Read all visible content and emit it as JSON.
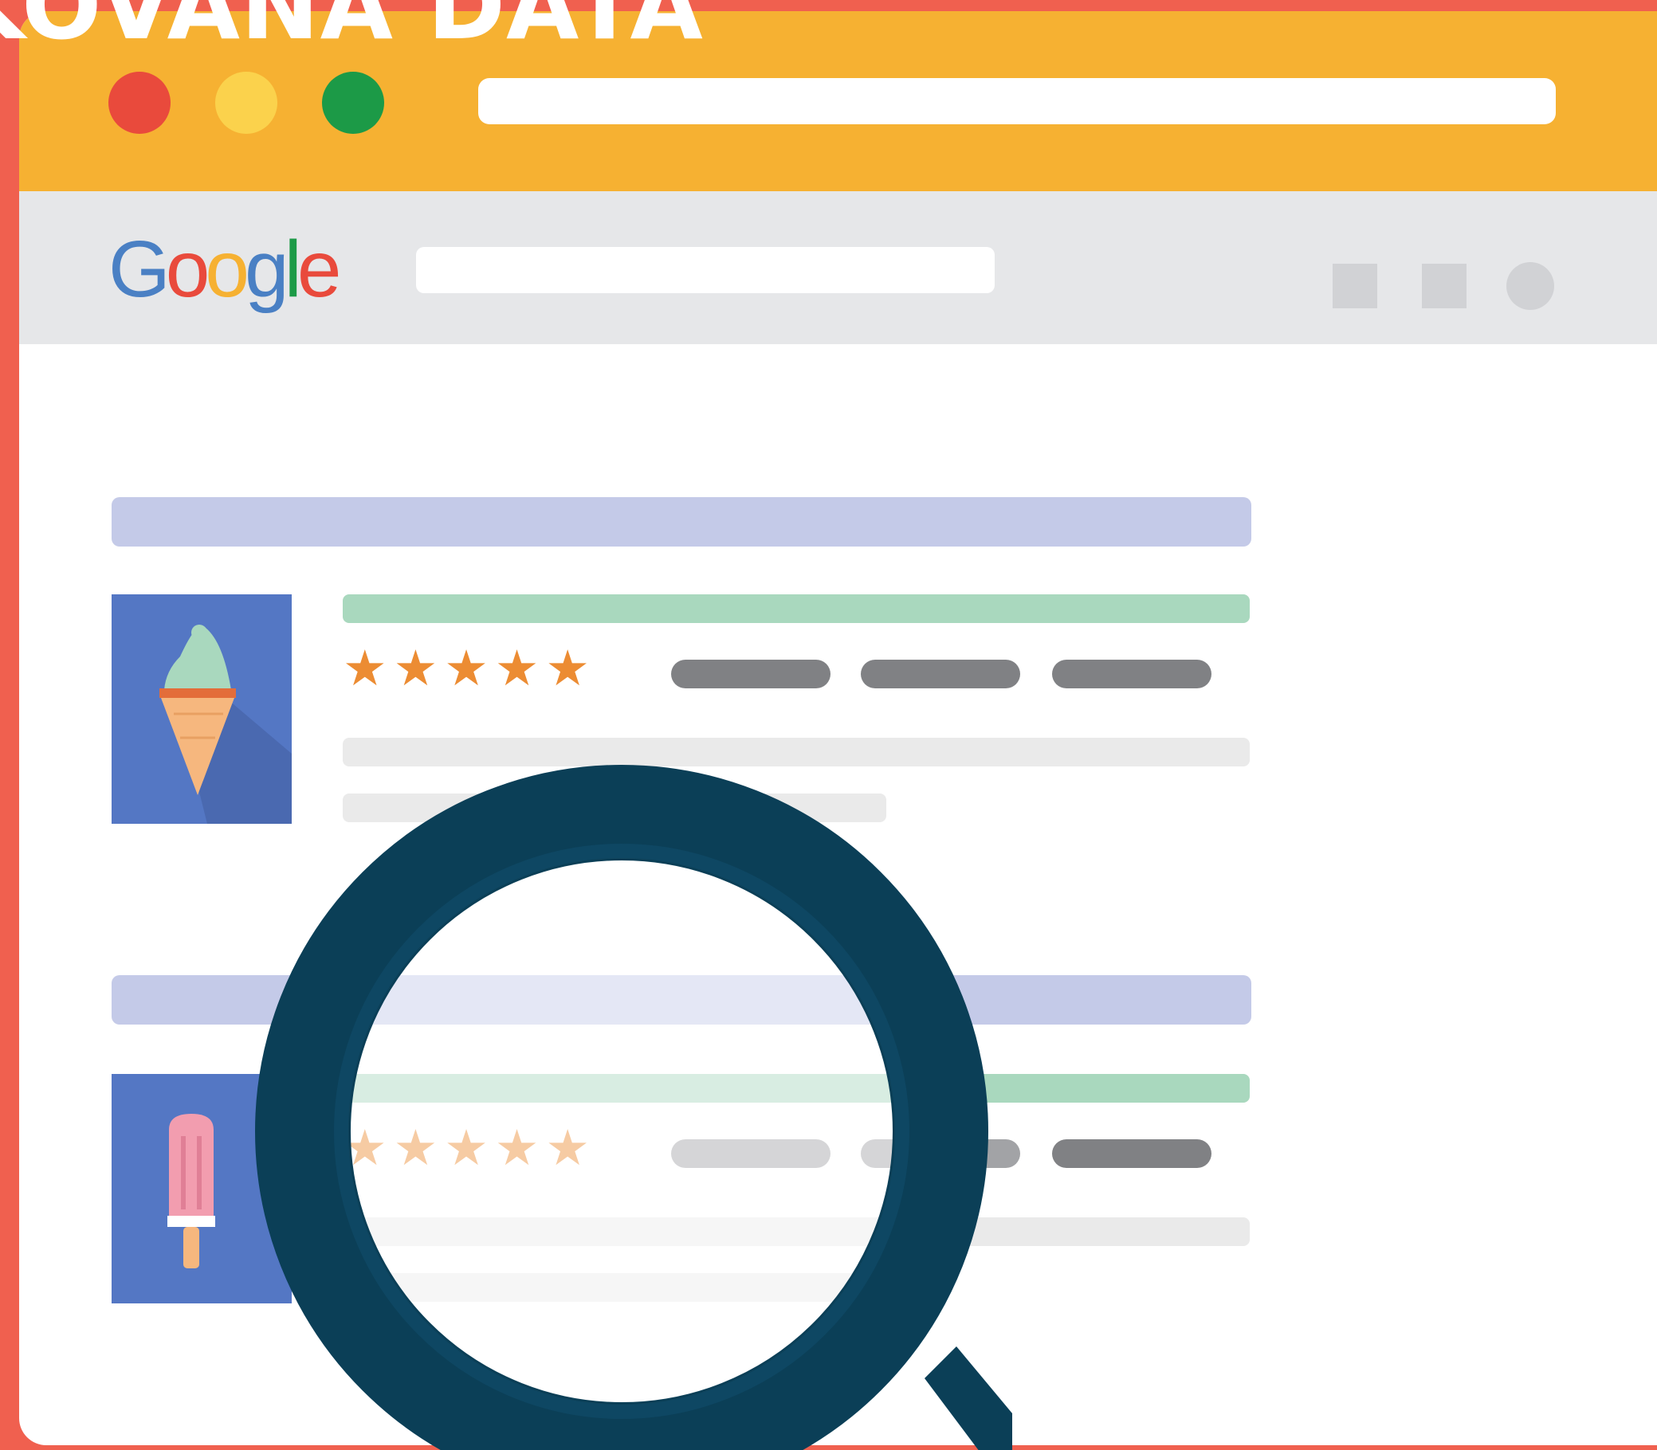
{
  "headline": {
    "text": "KOVANÁ DATA"
  },
  "browser": {
    "traffic_lights": [
      {
        "name": "close",
        "color": "#E94A3C"
      },
      {
        "name": "minimize",
        "color": "#FBD24C"
      },
      {
        "name": "maximize",
        "color": "#1C9A47"
      }
    ],
    "address_bar": {
      "value": ""
    },
    "accent_color": "#F6B132"
  },
  "google_bar": {
    "logo_letters": [
      {
        "char": "G",
        "color": "#4A80C4"
      },
      {
        "char": "o",
        "color": "#E94A3C"
      },
      {
        "char": "o",
        "color": "#F6B132"
      },
      {
        "char": "g",
        "color": "#4A80C4"
      },
      {
        "char": "l",
        "color": "#1C9A47"
      },
      {
        "char": "e",
        "color": "#E94A3C"
      }
    ],
    "search_value": "",
    "toolbar_icons": [
      "square-icon",
      "square-icon",
      "circle-icon"
    ]
  },
  "results": [
    {
      "thumbnail_icon": "ice-cream-cone-icon",
      "rating": 5,
      "star_glyph": "★",
      "meta_count": 3
    },
    {
      "thumbnail_icon": "popsicle-icon",
      "rating": 5,
      "star_glyph": "★",
      "meta_count": 3
    }
  ],
  "overlay": {
    "icon": "magnifying-glass-icon",
    "color": "#0B3F57"
  }
}
